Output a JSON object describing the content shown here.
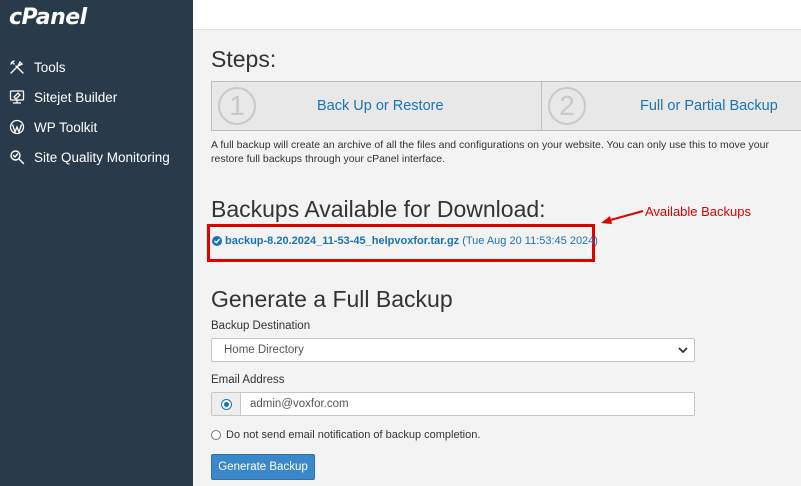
{
  "app": {
    "logo": "cPanel"
  },
  "sidebar": {
    "items": [
      {
        "label": "Tools",
        "icon": "tools-icon"
      },
      {
        "label": "Sitejet Builder",
        "icon": "sitejet-icon"
      },
      {
        "label": "WP Toolkit",
        "icon": "wordpress-icon"
      },
      {
        "label": "Site Quality Monitoring",
        "icon": "site-quality-icon"
      }
    ]
  },
  "steps": {
    "heading": "Steps:",
    "items": [
      {
        "number": "1",
        "label": "Back Up or Restore"
      },
      {
        "number": "2",
        "label": "Full or Partial Backup"
      }
    ],
    "description": "A full backup will create an archive of all the files and configurations on your website. You can only use this to move your restore full backups through your cPanel interface."
  },
  "backups": {
    "heading": "Backups Available for Download:",
    "items": [
      {
        "filename": "backup-8.20.2024_11-53-45_helpvoxfor.tar.gz",
        "date": "(Tue Aug 20 11:53:45 2024)"
      }
    ],
    "annotation": "Available Backups",
    "annotation_color": "#e00000"
  },
  "generate": {
    "heading": "Generate a Full Backup",
    "destination_label": "Backup Destination",
    "destination_value": "Home Directory",
    "email_label": "Email Address",
    "email_value": "admin@voxfor.com",
    "no_email_label": "Do not send email notification of backup completion.",
    "button_label": "Generate Backup"
  },
  "colors": {
    "sidebar_bg": "#293a4a",
    "link": "#1a73b8",
    "button": "#3a87c9"
  }
}
